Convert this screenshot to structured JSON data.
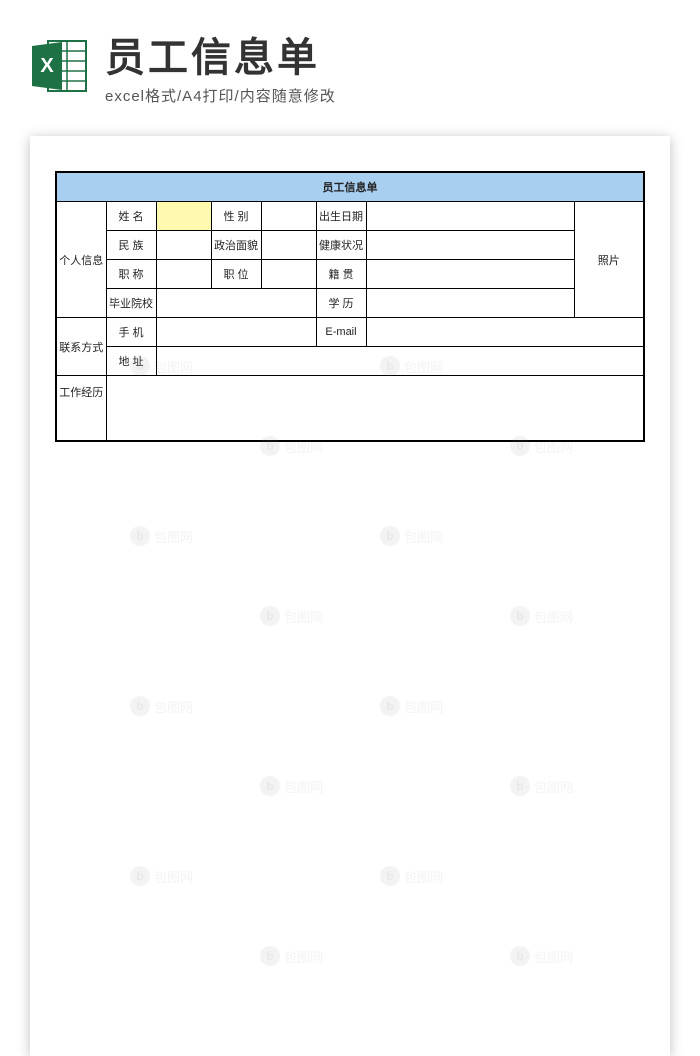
{
  "header": {
    "title": "员工信息单",
    "subtitle": "excel格式/A4打印/内容随意修改"
  },
  "form": {
    "title": "员工信息单",
    "sections": {
      "personal_info": "个人信息",
      "contact": "联系方式",
      "work_history": "工作经历"
    },
    "labels": {
      "name": "姓  名",
      "gender": "性  别",
      "birth_date": "出生日期",
      "ethnicity": "民  族",
      "political": "政治面貌",
      "health": "健康状况",
      "title": "职  称",
      "position": "职  位",
      "native_place": "籍  贯",
      "school": "毕业院校",
      "education": "学  历",
      "phone": "手  机",
      "email": "E-mail",
      "address": "地  址",
      "photo": "照片"
    }
  },
  "watermark": {
    "text": "包图网"
  }
}
